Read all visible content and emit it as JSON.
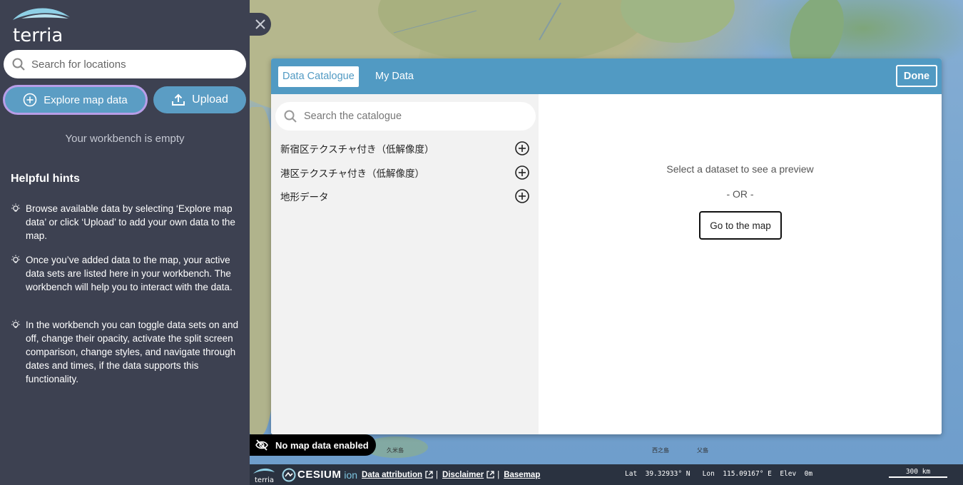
{
  "app": {
    "name": "terria"
  },
  "sidebar": {
    "search_placeholder": "Search for locations",
    "explore_label": "Explore map data",
    "upload_label": "Upload",
    "workbench_empty": "Your workbench is empty",
    "hints_title": "Helpful hints",
    "hints": [
      "Browse available data by selecting ‘Explore map data’ or click ‘Upload’ to add your own data to the map.",
      "Once you’ve added data to the map, your active data sets are listed here in your workbench. The workbench will help you to interact with the data.",
      "In the workbench you can toggle data sets on and off, change their opacity, activate the split screen comparison, change styles, and navigate through dates and times, if the data supports this functionality."
    ]
  },
  "modal": {
    "tabs": [
      {
        "label": "Data Catalogue",
        "active": true
      },
      {
        "label": "My Data",
        "active": false
      }
    ],
    "done_label": "Done",
    "catalogue_search_placeholder": "Search the catalogue",
    "catalogue_items": [
      {
        "label": "新宿区テクスチャ付き（低解像度）"
      },
      {
        "label": "港区テクスチャ付き（低解像度）"
      },
      {
        "label": "地形データ"
      }
    ],
    "preview": {
      "message": "Select a dataset to see a preview",
      "or": "- OR -",
      "goto_label": "Go to the map"
    }
  },
  "map_labels": {
    "label1": "久米島",
    "label2": "西之島",
    "label3": "父島"
  },
  "status": {
    "no_data": "No map data enabled",
    "cesium_label": "CESIUM",
    "ion_label": "ion",
    "attribution": "Data attribution",
    "disclaimer": "Disclaimer",
    "basemap": "Basemap",
    "separator": "|",
    "coords": "Lat  39.32933° N   Lon  115.09167° E  Elev  0m",
    "scale": "300 km"
  },
  "colors": {
    "sidebar_bg": "#3d4151",
    "accent": "#519ac3",
    "button_bg": "#5b9dc4",
    "focus_ring": "#b89ee8"
  },
  "icons": [
    "search-icon",
    "plus-circle-icon",
    "upload-icon",
    "lightbulb-icon",
    "close-icon",
    "eye-off-icon",
    "external-link-icon"
  ]
}
